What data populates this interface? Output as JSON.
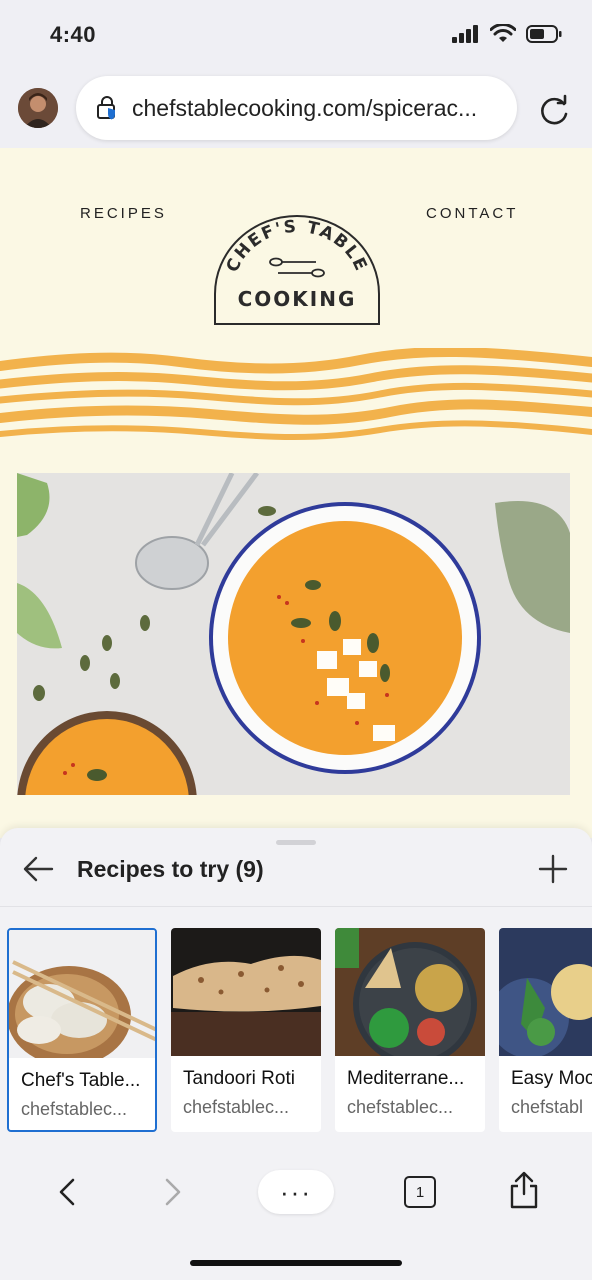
{
  "status": {
    "time": "4:40"
  },
  "browser": {
    "url": "chefstablecooking.com/spicerac...",
    "icons": {
      "avatar": "user-avatar",
      "site": "site-lock-icon",
      "reload": "reload-icon"
    }
  },
  "site": {
    "nav": {
      "recipes": "RECIPES",
      "contact": "CONTACT"
    },
    "logo": {
      "line1": "CHEF'S TABLE",
      "line2": "COOKING"
    },
    "colors": {
      "background": "#fbf8e4",
      "wave": "#f2b24c",
      "soup": "#f3a02e"
    }
  },
  "sheet": {
    "title": "Recipes to try (9)",
    "cards": [
      {
        "title": "Chef's Table...",
        "source": "chefstablec...",
        "selected": true
      },
      {
        "title": "Tandoori Roti",
        "source": "chefstablec..."
      },
      {
        "title": "Mediterrane...",
        "source": "chefstablec..."
      },
      {
        "title": "Easy Moc",
        "source": "chefstabl"
      }
    ]
  },
  "toolbar": {
    "more": "···",
    "tabs": "1"
  },
  "colors": {
    "accent": "#1f6fd1",
    "surface": "#f2f2f5"
  }
}
